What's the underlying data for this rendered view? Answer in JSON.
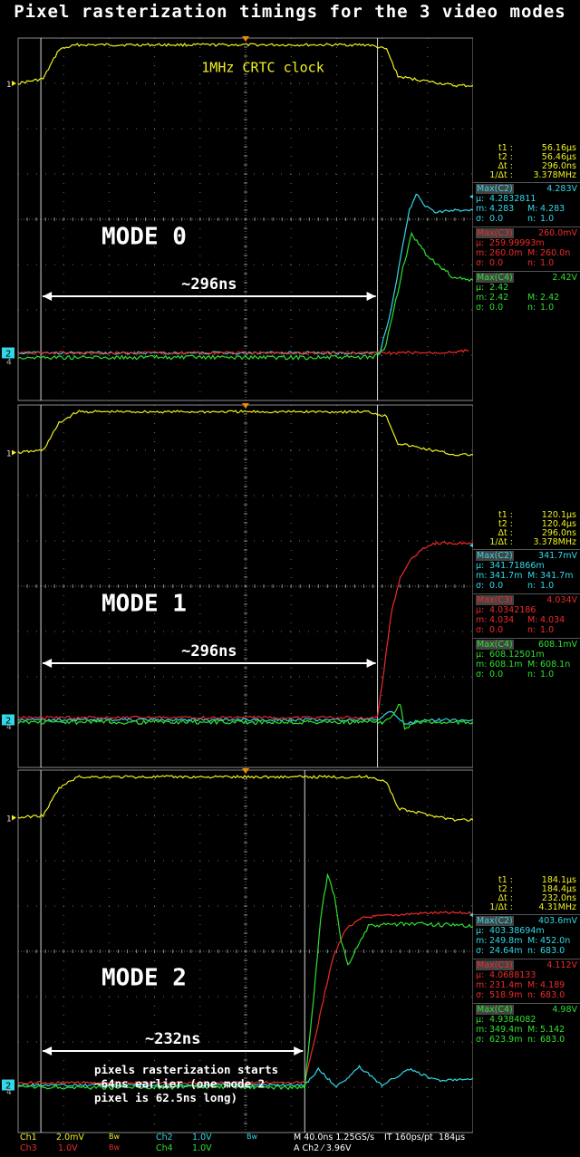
{
  "title": "Pixel rasterization timings for the 3 video modes",
  "colors": {
    "ch1": "#f0f020",
    "ch2": "#30d8e8",
    "ch3": "#ee2a2a",
    "ch4": "#2ee02e",
    "grid": "#8a8a8a",
    "annot": "#ffffff"
  },
  "chart_data": [
    {
      "type": "line",
      "title": "MODE 0",
      "annotation": "1MHz CRTC clock",
      "interval_label": "~296ns",
      "note": "",
      "cursor_t1_div": -4.5,
      "cursor_t2_div": 2.9,
      "series": [
        {
          "name": "Ch1",
          "channel": "ch1",
          "marker": "1",
          "points": [
            [
              -5,
              3.0
            ],
            [
              -4.45,
              3.1
            ],
            [
              -4.1,
              3.75
            ],
            [
              -3.7,
              3.85
            ],
            [
              2.7,
              3.85
            ],
            [
              3.1,
              3.75
            ],
            [
              3.35,
              3.15
            ],
            [
              4.6,
              2.95
            ],
            [
              5,
              2.95
            ]
          ]
        },
        {
          "name": "Ch2",
          "channel": "ch2",
          "marker": "2",
          "points": [
            [
              -5,
              -2.95
            ],
            [
              2.95,
              -2.95
            ],
            [
              3.2,
              -2.0
            ],
            [
              3.45,
              -0.6
            ],
            [
              3.6,
              0.2
            ],
            [
              3.75,
              0.55
            ],
            [
              3.95,
              0.3
            ],
            [
              4.2,
              0.15
            ],
            [
              4.6,
              0.2
            ],
            [
              5,
              0.2
            ]
          ]
        },
        {
          "name": "Ch3",
          "channel": "ch3",
          "marker": "",
          "points": [
            [
              -5,
              -2.95
            ],
            [
              3.0,
              -2.95
            ],
            [
              4.2,
              -2.95
            ],
            [
              4.9,
              -2.9
            ]
          ]
        },
        {
          "name": "Ch4",
          "channel": "ch4",
          "marker": "4",
          "points": [
            [
              -5,
              -3.05
            ],
            [
              2.8,
              -3.05
            ],
            [
              3.05,
              -2.9
            ],
            [
              3.3,
              -1.8
            ],
            [
              3.5,
              -0.9
            ],
            [
              3.65,
              -0.35
            ],
            [
              3.8,
              -0.55
            ],
            [
              4.0,
              -0.8
            ],
            [
              4.2,
              -1.0
            ],
            [
              4.6,
              -1.3
            ],
            [
              5,
              -1.35
            ]
          ]
        }
      ],
      "measure": {
        "t1": "56.16µs",
        "t2": "56.46µs",
        "dt": "296.0ns",
        "inv_dt": "3.378MHz",
        "c2": {
          "hdr": "Max(C2)",
          "val": "4.283V",
          "mu": "4.2832811",
          "m": "4.283",
          "M": "4.283",
          "sigma": "0.0",
          "n": "1.0"
        },
        "c3": {
          "hdr": "Max(C3)",
          "val": "260.0mV",
          "mu": "259.99993m",
          "m": "260.0m",
          "M": "260.0n",
          "sigma": "0.0",
          "n": "1.0"
        },
        "c4": {
          "hdr": "Max(C4)",
          "val": "2.42V",
          "mu": "2.42",
          "m": "2.42",
          "M": "2.42",
          "sigma": "0.0",
          "n": "1.0"
        }
      }
    },
    {
      "type": "line",
      "title": "MODE 1",
      "annotation": "",
      "interval_label": "~296ns",
      "note": "",
      "cursor_t1_div": -4.5,
      "cursor_t2_div": 2.9,
      "series": [
        {
          "name": "Ch1",
          "channel": "ch1",
          "marker": "1",
          "points": [
            [
              -5,
              2.95
            ],
            [
              -4.45,
              3.0
            ],
            [
              -4.1,
              3.6
            ],
            [
              -3.7,
              3.85
            ],
            [
              2.7,
              3.85
            ],
            [
              3.1,
              3.75
            ],
            [
              3.35,
              3.15
            ],
            [
              4.6,
              2.9
            ],
            [
              5,
              2.9
            ]
          ]
        },
        {
          "name": "Ch2",
          "channel": "ch2",
          "marker": "2",
          "points": [
            [
              -5,
              -2.95
            ],
            [
              2.9,
              -2.95
            ],
            [
              3.2,
              -2.75
            ],
            [
              3.5,
              -3.05
            ],
            [
              3.9,
              -2.95
            ],
            [
              5,
              -2.95
            ]
          ]
        },
        {
          "name": "Ch3",
          "channel": "ch3",
          "marker": "",
          "points": [
            [
              -5,
              -2.9
            ],
            [
              2.9,
              -2.9
            ],
            [
              3.05,
              -1.8
            ],
            [
              3.2,
              -0.6
            ],
            [
              3.4,
              0.2
            ],
            [
              3.6,
              0.55
            ],
            [
              3.9,
              0.85
            ],
            [
              4.2,
              0.95
            ],
            [
              5,
              0.95
            ]
          ]
        },
        {
          "name": "Ch4",
          "channel": "ch4",
          "marker": "4",
          "points": [
            [
              -5,
              -3.0
            ],
            [
              3.0,
              -3.0
            ],
            [
              3.2,
              -2.85
            ],
            [
              3.4,
              -2.6
            ],
            [
              3.5,
              -3.2
            ],
            [
              3.7,
              -3.0
            ],
            [
              5,
              -3.0
            ]
          ]
        }
      ],
      "measure": {
        "t1": "120.1µs",
        "t2": "120.4µs",
        "dt": "296.0ns",
        "inv_dt": "3.378MHz",
        "c2": {
          "hdr": "Max(C2)",
          "val": "341.7mV",
          "mu": "341.71866m",
          "m": "341.7m",
          "M": "341.7m",
          "sigma": "0.0",
          "n": "1.0"
        },
        "c3": {
          "hdr": "Max(C3)",
          "val": "4.034V",
          "mu": "4.0342186",
          "m": "4.034",
          "M": "4.034",
          "sigma": "0.0",
          "n": "1.0"
        },
        "c4": {
          "hdr": "Max(C4)",
          "val": "608.1mV",
          "mu": "608.12501m",
          "m": "608.1m",
          "M": "608.1n",
          "sigma": "0.0",
          "n": "1.0"
        }
      }
    },
    {
      "type": "line",
      "title": "MODE 2",
      "annotation": "",
      "interval_label": "~232ns",
      "note": "pixels rasterization starts\n~64ns earlier (one mode 2\npixel is 62.5ns long)",
      "cursor_t1_div": -4.5,
      "cursor_t2_div": 1.3,
      "series": [
        {
          "name": "Ch1",
          "channel": "ch1",
          "marker": "1",
          "points": [
            [
              -5,
              2.95
            ],
            [
              -4.45,
              3.0
            ],
            [
              -4.1,
              3.6
            ],
            [
              -3.7,
              3.85
            ],
            [
              2.7,
              3.85
            ],
            [
              3.1,
              3.75
            ],
            [
              3.35,
              3.15
            ],
            [
              4.6,
              2.9
            ],
            [
              5,
              2.9
            ]
          ]
        },
        {
          "name": "Ch2",
          "channel": "ch2",
          "marker": "2",
          "points": [
            [
              -5,
              -2.95
            ],
            [
              1.3,
              -2.95
            ],
            [
              1.6,
              -2.6
            ],
            [
              2.0,
              -3.0
            ],
            [
              2.5,
              -2.55
            ],
            [
              3.0,
              -2.95
            ],
            [
              3.6,
              -2.6
            ],
            [
              4.2,
              -2.85
            ],
            [
              5,
              -2.8
            ]
          ]
        },
        {
          "name": "Ch3",
          "channel": "ch3",
          "marker": "",
          "points": [
            [
              -5,
              -2.9
            ],
            [
              1.3,
              -2.9
            ],
            [
              1.55,
              -1.8
            ],
            [
              1.9,
              -0.2
            ],
            [
              2.2,
              0.5
            ],
            [
              2.6,
              0.75
            ],
            [
              3.2,
              0.8
            ],
            [
              4.0,
              0.85
            ],
            [
              5,
              0.85
            ]
          ]
        },
        {
          "name": "Ch4",
          "channel": "ch4",
          "marker": "4",
          "points": [
            [
              -5,
              -3.0
            ],
            [
              1.3,
              -3.0
            ],
            [
              1.5,
              -1.0
            ],
            [
              1.65,
              0.7
            ],
            [
              1.8,
              1.7
            ],
            [
              1.95,
              1.2
            ],
            [
              2.1,
              0.2
            ],
            [
              2.25,
              -0.3
            ],
            [
              2.45,
              0.1
            ],
            [
              2.7,
              0.55
            ],
            [
              3.2,
              0.6
            ],
            [
              4.0,
              0.6
            ],
            [
              5,
              0.55
            ]
          ]
        }
      ],
      "measure": {
        "t1": "184.1µs",
        "t2": "184.4µs",
        "dt": "232.0ns",
        "inv_dt": "4.31MHz",
        "c2": {
          "hdr": "Max(C2)",
          "val": "403.6mV",
          "mu": "403.38694m",
          "m": "249.8m",
          "M": "452.0n",
          "sigma": "24.64m",
          "n": "683.0"
        },
        "c3": {
          "hdr": "Max(C3)",
          "val": "4.112V",
          "mu": "4.0688133",
          "m": "231.4m",
          "M": "4.189",
          "sigma": "518.9m",
          "n": "683.0"
        },
        "c4": {
          "hdr": "Max(C4)",
          "val": "4.98V",
          "mu": "4.9384082",
          "m": "349.4m",
          "M": "5.142",
          "sigma": "623.9m",
          "n": "683.0"
        }
      }
    }
  ],
  "labels": {
    "t1": "t1 :",
    "t2": "t2 :",
    "dt": "Δt :",
    "inv_dt": "1/Δt :",
    "mu": "µ:",
    "m": "m:",
    "M": "M:",
    "sigma": "σ:",
    "n": "n:"
  },
  "footer": {
    "ch1": "Ch1",
    "ch1_scale": "2.0mV",
    "ch3": "Ch3",
    "ch3_scale": "1.0V",
    "bw1": "Bw",
    "bw2": "Bw",
    "bw3": "Bw",
    "ch2": "Ch2",
    "ch2_scale": "1.0V",
    "ch4": "Ch4",
    "ch4_scale": "1.0V",
    "timebase": "M 40.0ns 1.25GS/s",
    "interp": "IT 160ps/pt",
    "points": "184µs",
    "trigger": "A  Ch2  ⁄  3.96V"
  }
}
